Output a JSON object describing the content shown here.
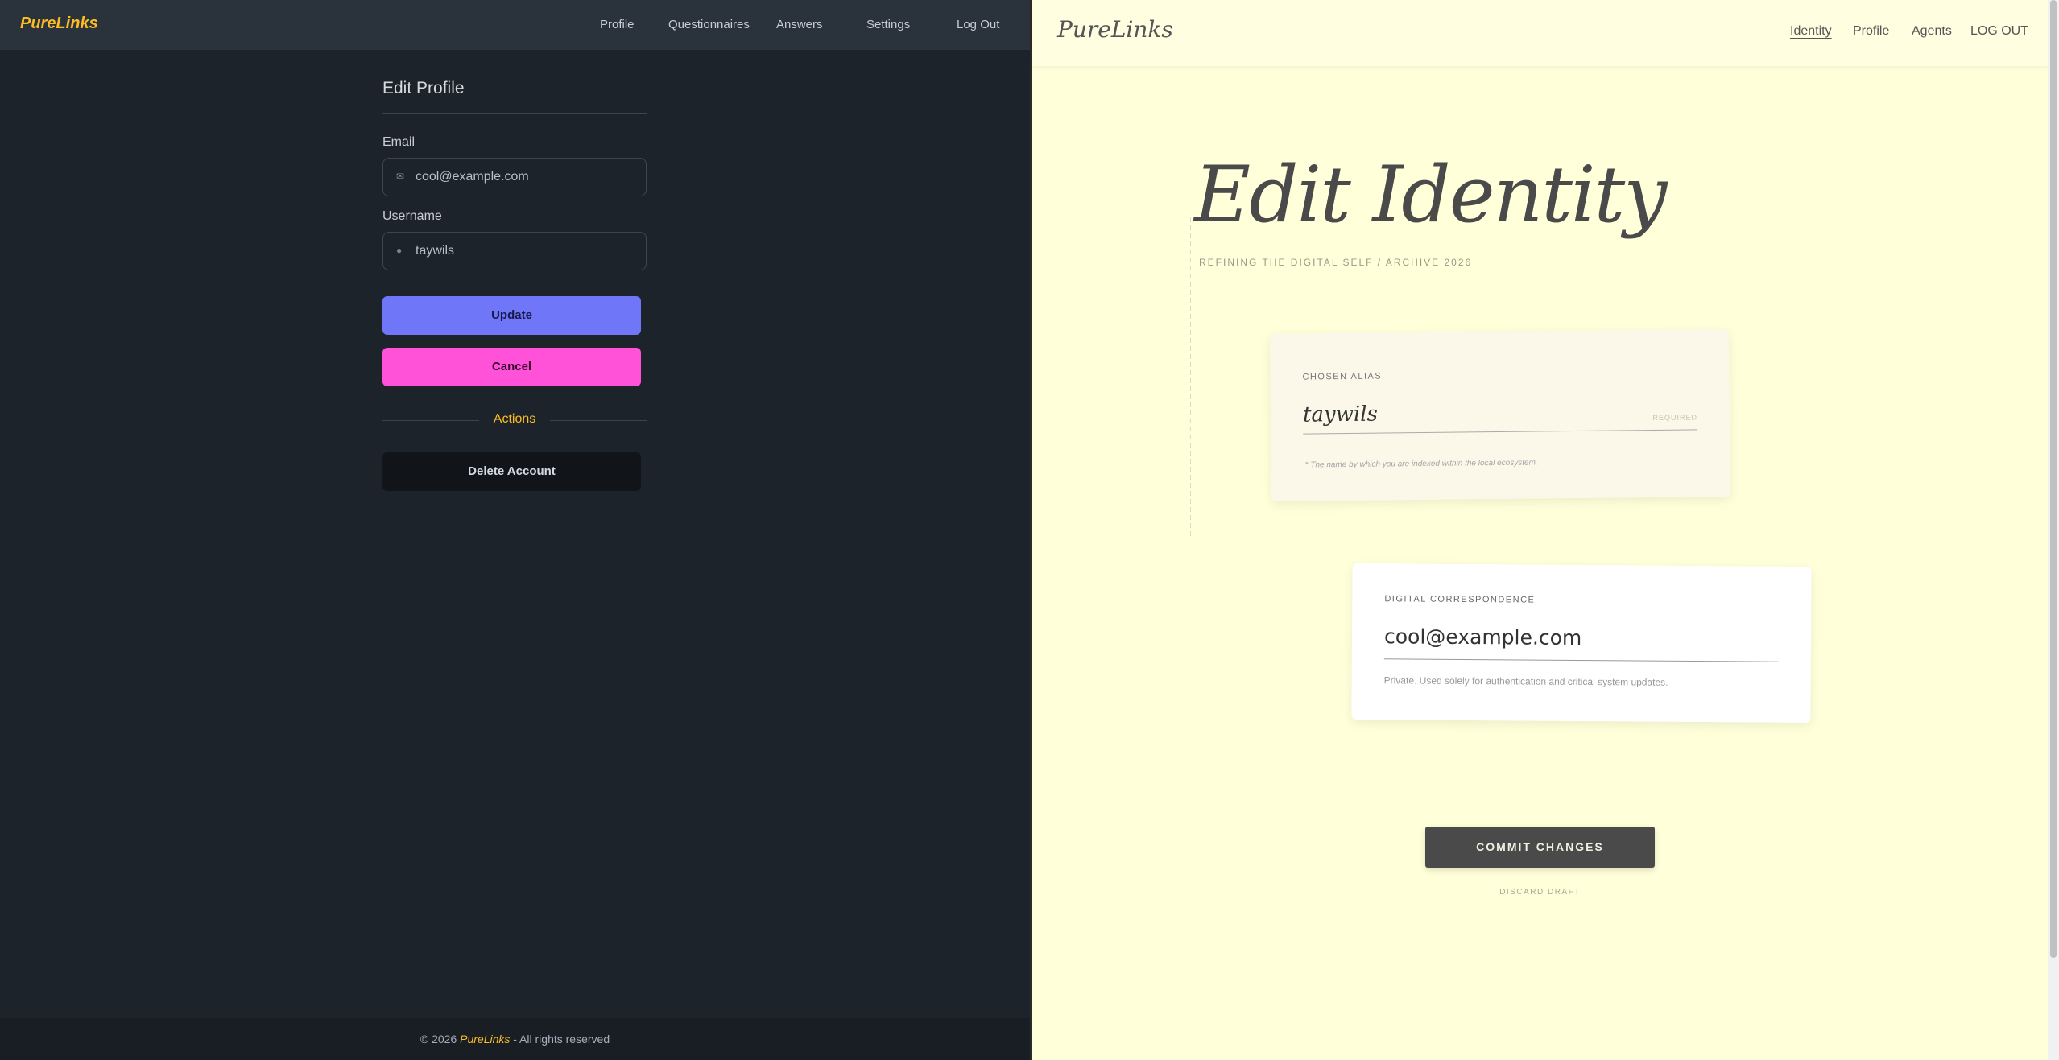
{
  "left": {
    "brand": "PureLinks",
    "nav": [
      "Profile",
      "Questionnaires",
      "Answers",
      "Settings",
      "Log Out"
    ],
    "title": "Edit Profile",
    "email_label": "Email",
    "email_value": "cool@example.com",
    "email_icon": "envelope-icon",
    "username_label": "Username",
    "username_value": "taywils",
    "username_icon": "user-icon",
    "update_label": "Update",
    "cancel_label": "Cancel",
    "actions_label": "Actions",
    "delete_label": "Delete Account",
    "footer_prefix": "© 2026",
    "footer_brand": "PureLinks",
    "footer_suffix": "- All rights reserved",
    "colors": {
      "accent": "#fbbd23",
      "primary": "#7076f8",
      "secondary": "#ff52d9"
    }
  },
  "right": {
    "brand": "PureLinks",
    "nav": [
      "Identity",
      "Profile",
      "Agents",
      "LOG OUT"
    ],
    "title": "Edit Identity",
    "subtitle": "REFINING THE DIGITAL SELF / ARCHIVE 2026",
    "alias_label": "CHOSEN ALIAS",
    "alias_value": "taywils",
    "alias_required": "REQUIRED",
    "alias_hint": "* The name by which you are indexed within the local ecosystem.",
    "email_label": "DIGITAL CORRESPONDENCE",
    "email_value": "cool@example.com",
    "email_hint": "Private. Used solely for authentication and critical system updates.",
    "commit_label": "COMMIT CHANGES",
    "discard_label": "DISCARD DRAFT",
    "colors": {
      "background": "#ffffd9",
      "button": "#4a4a4a"
    }
  }
}
